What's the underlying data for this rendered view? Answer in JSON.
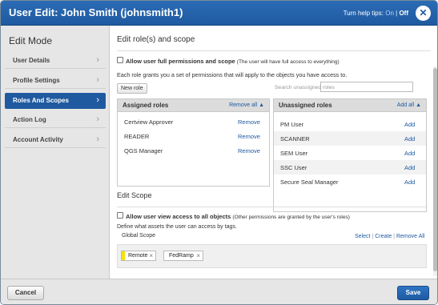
{
  "header": {
    "title": "User Edit: John Smith (johnsmith1)",
    "tips_label": "Turn help tips:",
    "tips_on": "On",
    "tips_sep": "|",
    "tips_off": "Off",
    "close_glyph": "✕"
  },
  "sidebar": {
    "title": "Edit Mode",
    "items": [
      {
        "label": "User Details",
        "chevron": "›"
      },
      {
        "label": "Profile Settings",
        "chevron": "›"
      },
      {
        "label": "Roles And Scopes",
        "chevron": "›"
      },
      {
        "label": "Action Log",
        "chevron": "›"
      },
      {
        "label": "Account Activity",
        "chevron": "›"
      }
    ]
  },
  "main": {
    "heading": "Edit role(s) and scope",
    "full_perm_label": "Allow user full permissions and scope",
    "full_perm_note": "(The user will have full access to everything)",
    "roles_desc": "Each role grants you a set of permissions that will apply to the objects you have access to.",
    "new_role_btn": "New role",
    "search_unassigned_placeholder": "Search unassigned roles",
    "assigned": {
      "title": "Assigned roles",
      "action": "Remove all",
      "rows": [
        {
          "name": "Certview Approver",
          "action": "Remove"
        },
        {
          "name": "READER",
          "action": "Remove"
        },
        {
          "name": "QGS Manager",
          "action": "Remove"
        }
      ]
    },
    "unassigned": {
      "title": "Unassigned roles",
      "action": "Add all",
      "rows": [
        {
          "name": "PM User",
          "action": "Add"
        },
        {
          "name": "SCANNER",
          "action": "Add"
        },
        {
          "name": "SEM User",
          "action": "Add"
        },
        {
          "name": "SSC User",
          "action": "Add"
        },
        {
          "name": "Secure Seal Manager",
          "action": "Add"
        }
      ]
    },
    "scope_heading": "Edit Scope",
    "view_all_label": "Allow user view access to all objects",
    "view_all_note": "(Other permissions are granted by the user's roles)",
    "scope_desc": "Define what assets the user can access by tags.",
    "global_scope": "Global Scope",
    "scope_links": {
      "select": "Select",
      "create": "Create",
      "remove_all": "Remove All",
      "sep": "|"
    },
    "tags": [
      {
        "label": "Remote",
        "color": "#f2e600"
      },
      {
        "label": "FedRamp",
        "color": ""
      }
    ]
  },
  "footer": {
    "cancel": "Cancel",
    "save": "Save"
  },
  "colors": {
    "header_blue": "#1f5aa0",
    "link_blue": "#1f5aa0"
  }
}
